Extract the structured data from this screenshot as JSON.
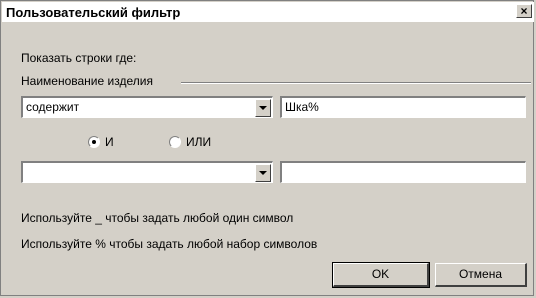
{
  "dialog": {
    "title": "Пользовательский фильтр",
    "close_glyph": "×",
    "show_rows_label": "Показать строки где:",
    "group_label": "Наименование изделия",
    "condition1": {
      "operator": "содержит",
      "value": "Шка%"
    },
    "logic": {
      "and_label": "И",
      "or_label": "ИЛИ",
      "selected": "and"
    },
    "condition2": {
      "operator": "",
      "value": ""
    },
    "hint1": "Используйте _ чтобы задать любой один символ",
    "hint2": "Используйте % чтобы задать любой набор символов",
    "ok_label": "OK",
    "cancel_label": "Отмена"
  }
}
